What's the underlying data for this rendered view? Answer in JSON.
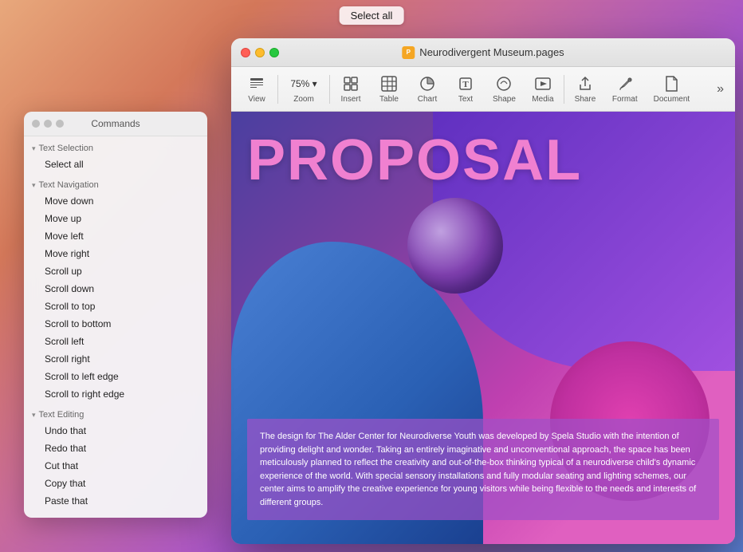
{
  "select_all_button": "Select all",
  "pages_window": {
    "title": "Neurodivergent Museum.pages",
    "traffic_lights": {
      "red": "close",
      "yellow": "minimize",
      "green": "maximize"
    },
    "toolbar": {
      "items": [
        {
          "id": "view",
          "icon": "☰",
          "label": "View"
        },
        {
          "id": "zoom",
          "icon": "75%",
          "label": "Zoom",
          "has_arrow": true
        },
        {
          "id": "insert",
          "icon": "⊕",
          "label": "Insert"
        },
        {
          "id": "table",
          "icon": "⊞",
          "label": "Table"
        },
        {
          "id": "chart",
          "icon": "◑",
          "label": "Chart"
        },
        {
          "id": "text",
          "icon": "T",
          "label": "Text"
        },
        {
          "id": "shape",
          "icon": "⬡",
          "label": "Shape"
        },
        {
          "id": "media",
          "icon": "⬜",
          "label": "Media"
        },
        {
          "id": "share",
          "icon": "↑",
          "label": "Share"
        },
        {
          "id": "format",
          "icon": "✏",
          "label": "Format"
        },
        {
          "id": "document",
          "icon": "📄",
          "label": "Document"
        }
      ],
      "more_icon": "»"
    },
    "document": {
      "proposal_title": "PROPOSAL",
      "body_text": "The design for The Alder Center for Neurodiverse Youth was developed by Spela Studio with the intention of providing delight and wonder. Taking an entirely imaginative and unconventional approach, the space has been meticulously planned to reflect the creativity and out-of-the-box thinking typical of a neurodiverse child's dynamic experience of the world. With special sensory installations and fully modular seating and lighting schemes, our center aims to amplify the creative experience for young visitors while being flexible to the needs and interests of different groups."
    }
  },
  "commands_panel": {
    "title": "Commands",
    "sections": [
      {
        "id": "text-selection",
        "label": "Text Selection",
        "items": [
          {
            "id": "select-all",
            "label": "Select all",
            "selected": false
          }
        ]
      },
      {
        "id": "text-navigation",
        "label": "Text Navigation",
        "items": [
          {
            "id": "move-down",
            "label": "Move down",
            "selected": false
          },
          {
            "id": "move-up",
            "label": "Move up",
            "selected": false
          },
          {
            "id": "move-left",
            "label": "Move left",
            "selected": false
          },
          {
            "id": "move-right",
            "label": "Move right",
            "selected": false
          },
          {
            "id": "scroll-up",
            "label": "Scroll up",
            "selected": false
          },
          {
            "id": "scroll-down",
            "label": "Scroll down",
            "selected": false
          },
          {
            "id": "scroll-to-top",
            "label": "Scroll to top",
            "selected": false
          },
          {
            "id": "scroll-to-bottom",
            "label": "Scroll to bottom",
            "selected": false
          },
          {
            "id": "scroll-left",
            "label": "Scroll left",
            "selected": false
          },
          {
            "id": "scroll-right",
            "label": "Scroll right",
            "selected": false
          },
          {
            "id": "scroll-to-left-edge",
            "label": "Scroll to left edge",
            "selected": false
          },
          {
            "id": "scroll-to-right-edge",
            "label": "Scroll to right edge",
            "selected": false
          }
        ]
      },
      {
        "id": "text-editing",
        "label": "Text Editing",
        "items": [
          {
            "id": "undo-that",
            "label": "Undo that",
            "selected": false
          },
          {
            "id": "redo-that",
            "label": "Redo that",
            "selected": false
          },
          {
            "id": "cut-that",
            "label": "Cut that",
            "selected": false
          },
          {
            "id": "copy-that",
            "label": "Copy that",
            "selected": false
          },
          {
            "id": "paste-that",
            "label": "Paste that",
            "selected": false
          }
        ]
      }
    ]
  }
}
